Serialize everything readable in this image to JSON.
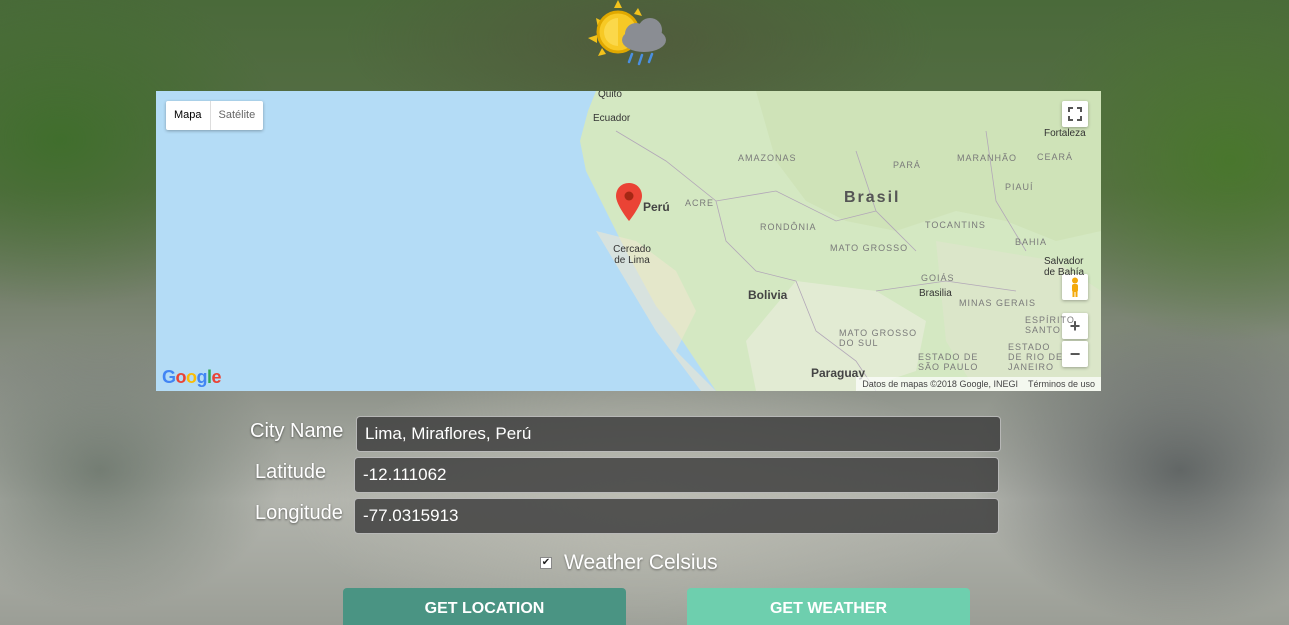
{
  "app": {
    "logo_icon": "sun-rain-cloud-icon"
  },
  "map": {
    "type_controls": {
      "map_label": "Mapa",
      "satellite_label": "Satélite"
    },
    "labels": {
      "quito": "Quito",
      "ecuador": "Ecuador",
      "amazonas": "AMAZONAS",
      "para": "PARÁ",
      "maranhao": "MARANHÃO",
      "ceara": "CEARÁ",
      "fortaleza": "Fortaleza",
      "piaui": "PIAUÍ",
      "brasil": "Brasil",
      "acre": "ACRE",
      "peru": "Perú",
      "rondonia": "RONDÔNIA",
      "tocantins": "TOCANTINS",
      "bahia": "BAHIA",
      "salvador": "Salvador de Bahía",
      "cercado": "Cercado de Lima",
      "mato_grosso": "MATO GROSSO",
      "goias": "GOIÁS",
      "brasilia": "Brasilia",
      "bolivia": "Bolivia",
      "minas": "MINAS GERAIS",
      "espirito": "ESPÍRITO SANTO",
      "mato_grosso_sul": "MATO GROSSO DO SUL",
      "sao_paulo": "ESTADO DE SÃO PAULO",
      "rio": "ESTADO DE RIO DE JANEIRO",
      "paraguay": "Paraguay"
    },
    "google_logo": [
      "G",
      "o",
      "o",
      "g",
      "l",
      "e"
    ],
    "attribution": "Datos de mapas ©2018 Google, INEGI",
    "terms": "Términos de uso",
    "zoom_in": "+",
    "zoom_out": "−"
  },
  "form": {
    "city": {
      "label": "City Name",
      "value": "Lima, Miraflores, Perú"
    },
    "latitude": {
      "label": "Latitude",
      "value": "-12.111062"
    },
    "longitude": {
      "label": "Longitude",
      "value": "-77.0315913"
    },
    "celsius": {
      "label": "Weather Celsius",
      "checked": true,
      "mark": "✔"
    }
  },
  "buttons": {
    "location": "GET LOCATION",
    "weather": "GET WEATHER"
  }
}
